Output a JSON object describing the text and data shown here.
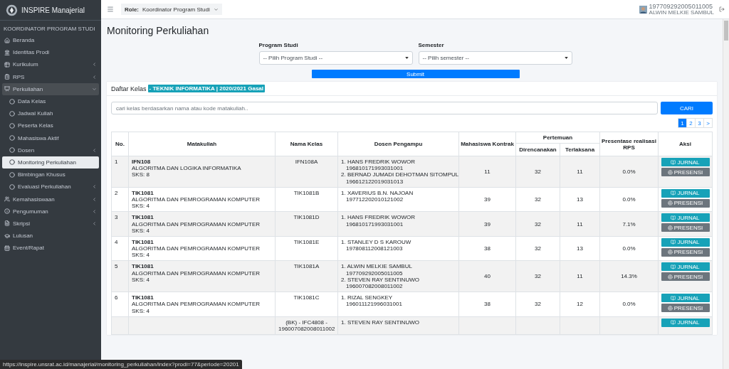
{
  "brand": {
    "title": "INSPIRE Manajerial"
  },
  "sidebar": {
    "heading": "KOORDINATOR PROGRAM STUDI",
    "items": [
      {
        "label": "Beranda",
        "has_caret": false,
        "selected": false
      },
      {
        "label": "Identitas Prodi",
        "has_caret": false,
        "selected": false
      },
      {
        "label": "Kurikulum",
        "has_caret": true,
        "selected": false
      },
      {
        "label": "RPS",
        "has_caret": true,
        "selected": false
      },
      {
        "label": "Perkuliahan",
        "has_caret": true,
        "selected": false,
        "expanded": true,
        "children": [
          {
            "label": "Data Kelas",
            "has_caret": false,
            "selected": false
          },
          {
            "label": "Jadwal Kuliah",
            "has_caret": false,
            "selected": false
          },
          {
            "label": "Peserta Kelas",
            "has_caret": false,
            "selected": false
          },
          {
            "label": "Mahasiswa Aktif",
            "has_caret": false,
            "selected": false
          },
          {
            "label": "Dosen",
            "has_caret": true,
            "selected": false
          },
          {
            "label": "Monitoring Perkuliahan",
            "has_caret": false,
            "selected": true
          },
          {
            "label": "Bimbingan Khusus",
            "has_caret": false,
            "selected": false
          },
          {
            "label": "Evaluasi Perkuliahan",
            "has_caret": true,
            "selected": false
          }
        ]
      },
      {
        "label": "Kemahasiswaan",
        "has_caret": true,
        "selected": false
      },
      {
        "label": "Pengumuman",
        "has_caret": true,
        "selected": false
      },
      {
        "label": "Skripsi",
        "has_caret": true,
        "selected": false
      },
      {
        "label": "Lulusan",
        "has_caret": false,
        "selected": false
      },
      {
        "label": "Event/Rapat",
        "has_caret": false,
        "selected": false
      }
    ]
  },
  "topbar": {
    "role_label": "Role:",
    "role_value": "Koordinator Program Studi",
    "user_id": "197709292005011005",
    "user_name": "ALWIN MELKIE SAMBUL"
  },
  "page_title": "Monitoring Perkuliahan",
  "filters": [
    {
      "label": "Program Studi",
      "value": "-- Pilih Program Studi --"
    },
    {
      "label": "Semester",
      "value": "-- Pilih semester --"
    }
  ],
  "submit_label": "Submit",
  "card": {
    "title": "Daftar Kelas",
    "badge": "- TEKNIK INFORMATIKA | 2020/2021 Gasal"
  },
  "search": {
    "placeholder": "cari kelas berdasarkan nama atau kode matakuliah..",
    "button": "CARI"
  },
  "pagination": [
    {
      "label": "1",
      "selected": true
    },
    {
      "label": "2",
      "selected": false
    },
    {
      "label": "3",
      "selected": false
    },
    {
      "label": ">",
      "selected": false
    }
  ],
  "table": {
    "columns": [
      "No.",
      "Matakuliah",
      "Nama Kelas",
      "Dosen Pengampu",
      "Mahasiswa Kontrak",
      "Pertemuan",
      "Presentase realisasi RPS",
      "Aksi"
    ],
    "subcolumns": [
      "Direncanakan",
      "Terlaksana"
    ],
    "rows": [
      {
        "no": "1",
        "code": "IFN108",
        "course": "ALGORITMA DAN LOGIKA INFORMATIKA",
        "sks": "SKS: 8",
        "class": "IFN108A",
        "lecturers": [
          {
            "name": "1. HANS FREDRIK WOWOR",
            "nip": "196810171993031001"
          },
          {
            "name": "2. BERNAD JUMADI DEHOTMAN SITOMPUL",
            "nip": "196612122019031013"
          }
        ],
        "students": "11",
        "planned": "32",
        "done": "11",
        "percent": "0.0%",
        "actions": [
          "JURNAL",
          "PRESENSI"
        ]
      },
      {
        "no": "2",
        "code": "TIK1081",
        "course": "ALGORITMA DAN PEMROGRAMAN KOMPUTER",
        "sks": "SKS: 4",
        "class": "TIK1081B",
        "lecturers": [
          {
            "name": "1. XAVERIUS B.N. NAJOAN",
            "nip": "197712202010121002"
          }
        ],
        "students": "39",
        "planned": "32",
        "done": "13",
        "percent": "0.0%",
        "actions": [
          "JURNAL",
          "PRESENSI"
        ]
      },
      {
        "no": "3",
        "code": "TIK1081",
        "course": "ALGORITMA DAN PEMROGRAMAN KOMPUTER",
        "sks": "SKS: 4",
        "class": "TIK1081D",
        "lecturers": [
          {
            "name": "1. HANS FREDRIK WOWOR",
            "nip": "196810171993031001"
          }
        ],
        "students": "39",
        "planned": "32",
        "done": "11",
        "percent": "7.1%",
        "actions": [
          "JURNAL",
          "PRESENSI"
        ]
      },
      {
        "no": "4",
        "code": "TIK1081",
        "course": "ALGORITMA DAN PEMROGRAMAN KOMPUTER",
        "sks": "SKS: 4",
        "class": "TIK1081E",
        "lecturers": [
          {
            "name": "1. STANLEY D S KAROUW",
            "nip": "197808112008121003"
          }
        ],
        "students": "38",
        "planned": "32",
        "done": "13",
        "percent": "0.0%",
        "actions": [
          "JURNAL",
          "PRESENSI"
        ]
      },
      {
        "no": "5",
        "code": "TIK1081",
        "course": "ALGORITMA DAN PEMROGRAMAN KOMPUTER",
        "sks": "SKS: 4",
        "class": "TIK1081A",
        "lecturers": [
          {
            "name": "1. ALWIN MELKIE SAMBUL",
            "nip": "197709292005011005"
          },
          {
            "name": "2. STEVEN RAY SENTINUWO",
            "nip": "196007082008011002"
          }
        ],
        "students": "40",
        "planned": "32",
        "done": "11",
        "percent": "14.3%",
        "actions": [
          "JURNAL",
          "PRESENSI"
        ]
      },
      {
        "no": "6",
        "code": "TIK1081",
        "course": "ALGORITMA DAN PEMROGRAMAN KOMPUTER",
        "sks": "SKS: 4",
        "class": "TIK1081C",
        "lecturers": [
          {
            "name": "1. RIZAL SENGKEY",
            "nip": "196011121996031001"
          }
        ],
        "students": "38",
        "planned": "32",
        "done": "12",
        "percent": "0.0%",
        "actions": [
          "JURNAL",
          "PRESENSI"
        ]
      },
      {
        "class": "(BK) - IFC4808 - 196007082008011002",
        "lecturers": [
          {
            "name": "1. STEVEN RAY SENTINUWO"
          }
        ],
        "actions": [
          "JURNAL"
        ]
      }
    ]
  },
  "status_url": "https://inspire.unsrat.ac.id/manajerial/monitoring_perkuliahan/index?prodi=77&periode=20201"
}
